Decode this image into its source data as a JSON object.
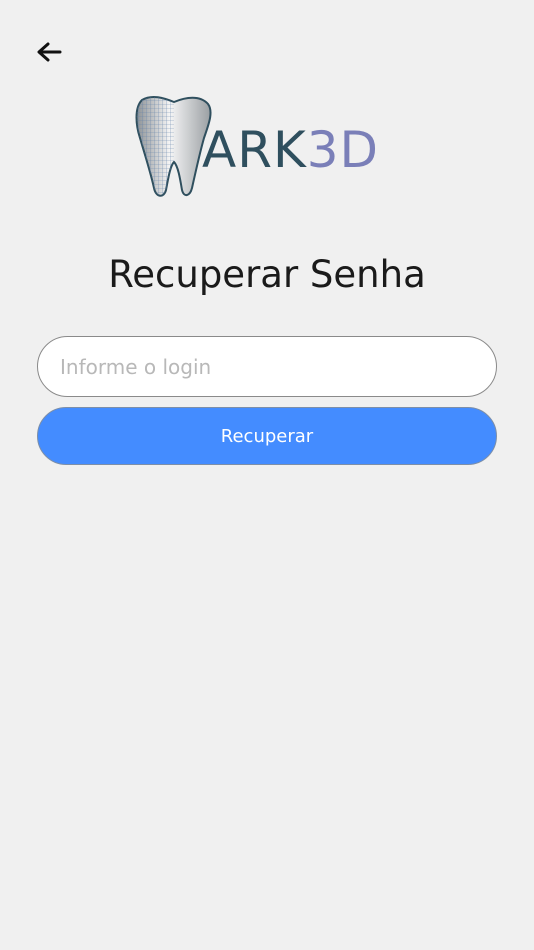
{
  "header": {
    "back_icon": "arrow-left-icon"
  },
  "logo": {
    "icon": "tooth-icon",
    "word_part1": "ARK",
    "word_part2": "3D",
    "colors": {
      "primary": "#2f4f5e",
      "secondary": "#7a7fb8"
    }
  },
  "page": {
    "title": "Recuperar Senha"
  },
  "form": {
    "login_placeholder": "Informe o login",
    "login_value": "",
    "submit_label": "Recuperar",
    "submit_color": "#448cff"
  }
}
